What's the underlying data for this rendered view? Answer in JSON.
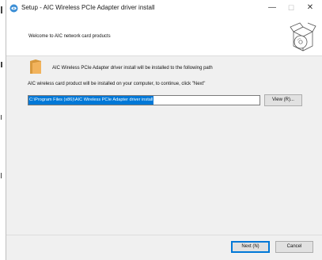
{
  "window": {
    "title": "Setup - AIC Wireless PCIe Adapter driver install",
    "minimize": "—",
    "maximize": "☐",
    "close": "✕"
  },
  "header": {
    "welcome": "Welcome to AIC network card products",
    "icon": "box-disc-icon"
  },
  "content": {
    "folder_icon": "folder-icon",
    "install_message": "AIC Wireless PCIe Adapter driver install will be installed to the following path",
    "instruction": "AIC wireless card product will be installed on your computer, to continue, click \"Next\"",
    "path_value": "C:\\Program Files (x86)\\AIC Wireless PCIe Adapter driver install",
    "view_button": "View (R)..."
  },
  "footer": {
    "next_button": "Next (N)",
    "cancel_button": "Cancel"
  },
  "colors": {
    "selection": "#0078d7",
    "dialog_bg": "#f0f0f0",
    "folder": "#f2b35c"
  }
}
